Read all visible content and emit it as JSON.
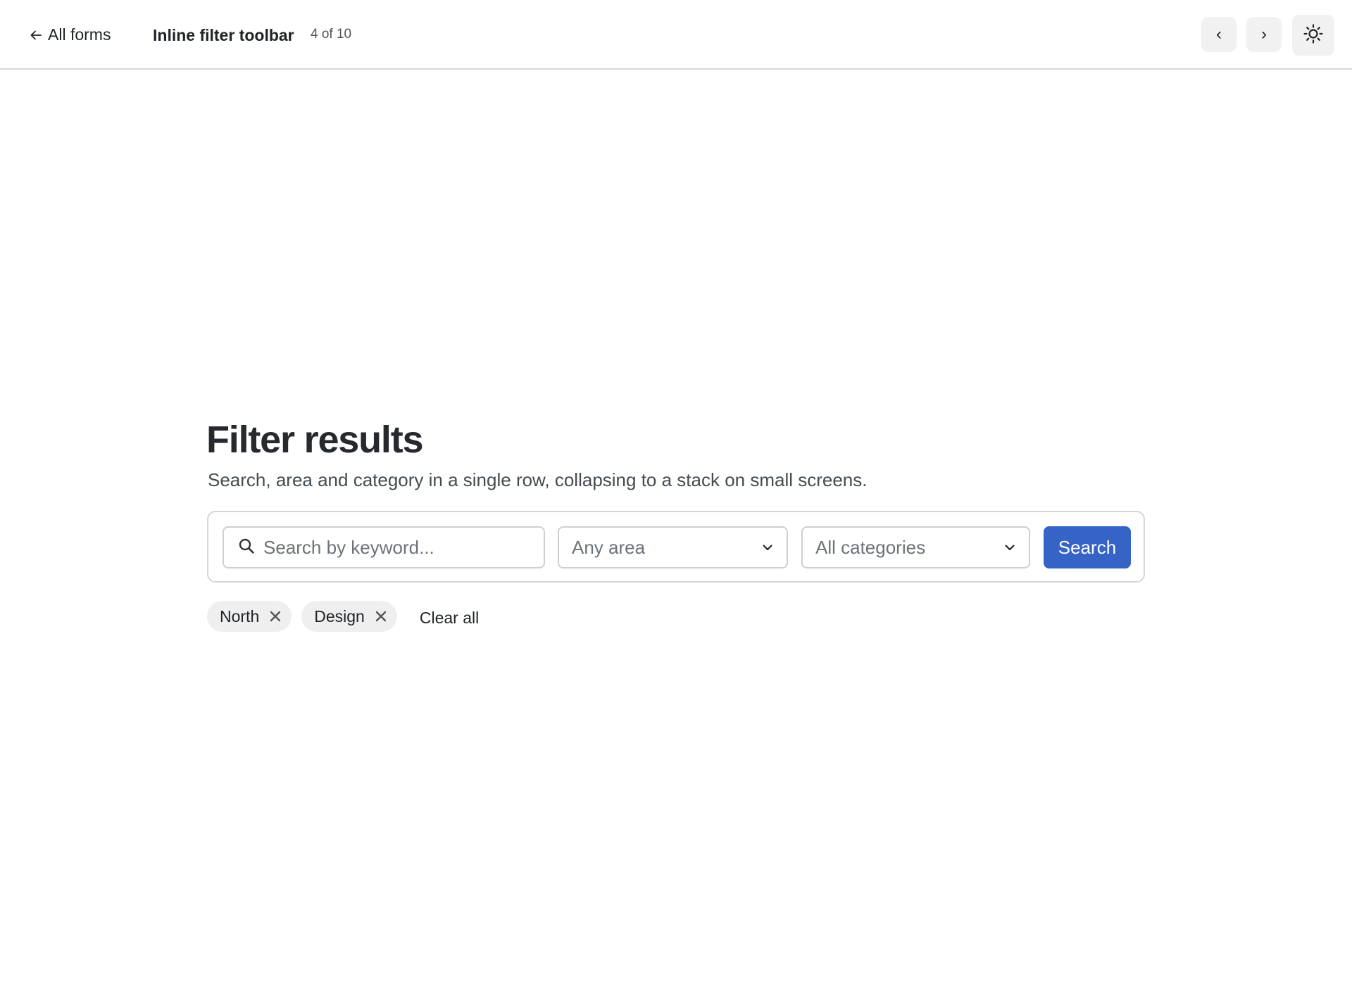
{
  "header": {
    "back_label": "All forms",
    "title": "Inline filter toolbar",
    "counter": "4 of 10",
    "prev_label": "‹",
    "next_label": "›",
    "theme_icon": "sun-icon"
  },
  "main": {
    "heading": "Filter results",
    "subtitle": "Search, area and category in a single row, collapsing to a stack on small screens."
  },
  "filters": {
    "search": {
      "placeholder": "Search by keyword...",
      "value": ""
    },
    "area": {
      "selected": "Any area"
    },
    "category": {
      "selected": "All categories"
    },
    "search_button_label": "Search"
  },
  "active_filters": {
    "chips": [
      {
        "label": "North"
      },
      {
        "label": "Design"
      }
    ],
    "clear_label": "Clear all"
  },
  "colors": {
    "accent": "#3563c6",
    "chip_bg": "#efefef",
    "nav_btn_bg": "#f1f1f1"
  }
}
